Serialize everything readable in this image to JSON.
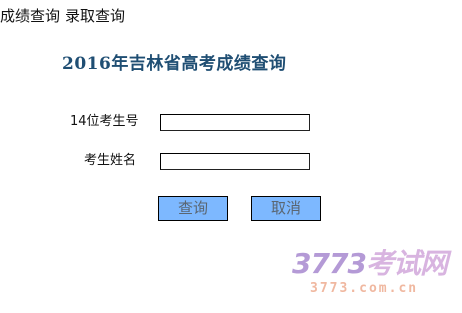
{
  "nav": {
    "score_query": "成绩查询",
    "admission_query": "录取查询"
  },
  "title": "2016年吉林省高考成绩查询",
  "form": {
    "exam_number_label": "14位考生号",
    "exam_number_value": "",
    "name_label": "考生姓名",
    "name_value": "",
    "query_button": "查询",
    "cancel_button": "取消"
  },
  "watermark": {
    "digits": "3773",
    "brand": "考试网",
    "url": "3773.com.cn"
  },
  "colors": {
    "title": "#1f4e73",
    "button_bg": "#7db8ff",
    "button_text": "#5a6672",
    "watermark_digits": "#b49ad6",
    "watermark_brand": "#d8b4e0",
    "watermark_url": "#f0b8a0"
  }
}
